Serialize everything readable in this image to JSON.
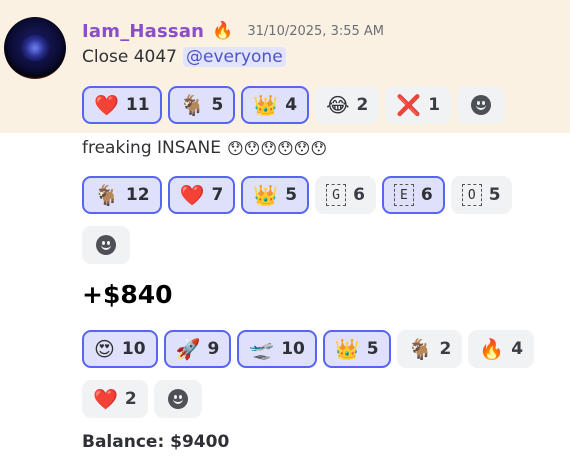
{
  "message": {
    "author": "Iam_Hassan",
    "author_badge": "🔥",
    "timestamp": "31/10/2025, 3:55 AM",
    "lines": {
      "close_text": "Close 4047",
      "mention": "@everyone",
      "freaking_text": "freaking INSANE",
      "freaking_emojis": "😯😯😯😯😯😯",
      "amount": "+$840",
      "balance": "Balance: $9400"
    }
  },
  "reactions_row1": [
    {
      "emoji": "❤️",
      "count": "11",
      "me": true,
      "name": "heart"
    },
    {
      "emoji": "🐐",
      "count": "5",
      "me": true,
      "name": "goat"
    },
    {
      "emoji": "👑",
      "count": "4",
      "me": true,
      "name": "crown"
    },
    {
      "emoji": "😂",
      "count": "2",
      "me": false,
      "name": "joy"
    },
    {
      "emoji": "❌",
      "count": "1",
      "me": false,
      "name": "x"
    }
  ],
  "reactions_row2": [
    {
      "emoji": "🐐",
      "count": "12",
      "me": true,
      "name": "goat"
    },
    {
      "emoji": "❤️",
      "count": "7",
      "me": true,
      "name": "heart"
    },
    {
      "emoji": "👑",
      "count": "5",
      "me": true,
      "name": "crown"
    },
    {
      "letter": "G",
      "count": "6",
      "me": false,
      "name": "letter-g"
    },
    {
      "letter": "E",
      "count": "6",
      "me": true,
      "name": "letter-e"
    },
    {
      "letter": "O",
      "count": "5",
      "me": false,
      "name": "letter-o"
    }
  ],
  "reactions_row3": [
    {
      "emoji": "😍",
      "count": "10",
      "me": true,
      "name": "heart-eyes"
    },
    {
      "emoji": "🚀",
      "count": "9",
      "me": true,
      "name": "rocket"
    },
    {
      "emoji": "🛫",
      "count": "10",
      "me": true,
      "name": "airplane"
    },
    {
      "emoji": "👑",
      "count": "5",
      "me": true,
      "name": "crown"
    },
    {
      "emoji": "🐐",
      "count": "2",
      "me": false,
      "name": "goat"
    },
    {
      "emoji": "🔥",
      "count": "4",
      "me": false,
      "name": "fire"
    }
  ],
  "reactions_row4": [
    {
      "emoji": "❤️",
      "count": "2",
      "me": false,
      "name": "heart"
    }
  ],
  "icons": {
    "add_reaction": "smiley-add-reaction-icon"
  },
  "colors": {
    "username": "#8a4ec9",
    "highlight": "#fbf1e2",
    "active_border": "#5865f2",
    "active_bg": "#dfe1fb",
    "mention": "#4d54c4"
  }
}
